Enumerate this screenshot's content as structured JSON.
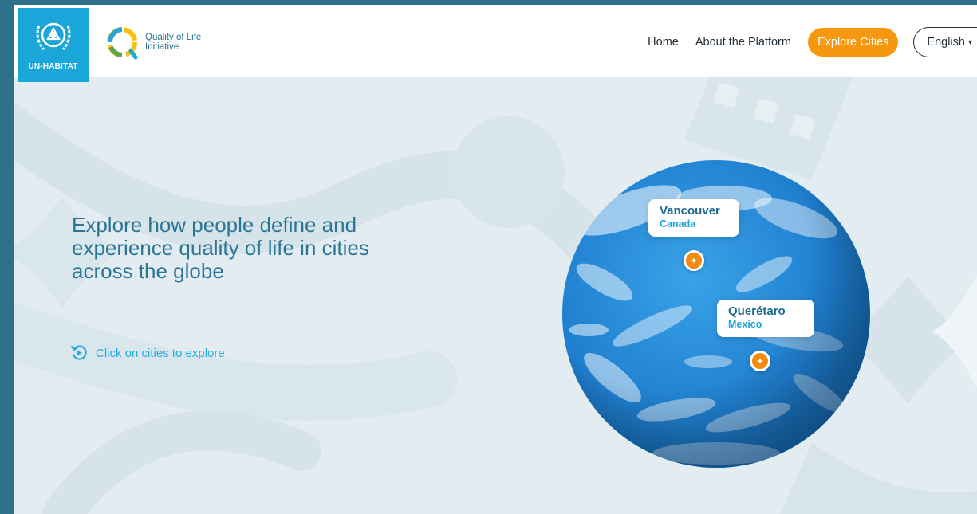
{
  "header": {
    "un_logo_text": "UN-HABITAT",
    "qol_logo_line1": "Quality of Life",
    "qol_logo_line2": "Initiative"
  },
  "nav": {
    "home": "Home",
    "about": "About the Platform",
    "explore": "Explore Cities",
    "language": "English",
    "language_icon": "chevron-down-icon"
  },
  "hero": {
    "headline": "Explore how people define and experience quality of life in cities across the globe",
    "hint": "Click on cities to explore",
    "hint_icon": "rotate-icon"
  },
  "cities": [
    {
      "name": "Vancouver",
      "country": "Canada"
    },
    {
      "name": "Querétaro",
      "country": "Mexico"
    }
  ],
  "colors": {
    "accent_orange": "#f7960f",
    "un_blue": "#1aa6d9",
    "headline_blue": "#2b7597",
    "page_background": "#e3edf1"
  }
}
